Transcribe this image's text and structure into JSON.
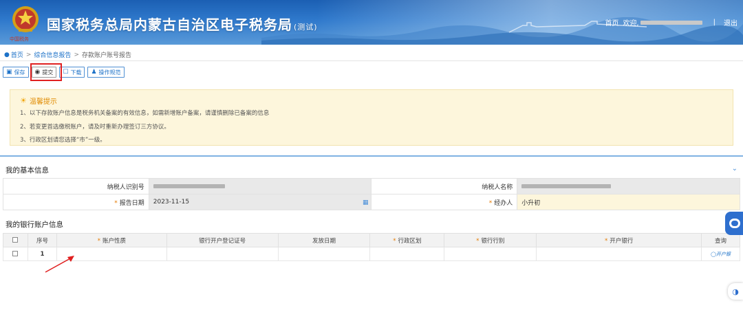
{
  "header": {
    "site_title": "国家税务总局内蒙古自治区电子税务局",
    "test_suffix": "(测试)",
    "logo_caption": "中国税务",
    "home_link": "首页",
    "welcome": "欢迎,",
    "separator": "|",
    "logout": "退出"
  },
  "breadcrumb": {
    "items": [
      "首页",
      "综合信息报告",
      "存款账户账号报告"
    ]
  },
  "toolbar": {
    "save": "保存",
    "submit": "提交",
    "download": "下载",
    "guide": "操作规范"
  },
  "tips": {
    "title": "温馨提示",
    "lines": [
      "1、以下存款账户信息是税务机关备案的有效信息，如需新增账户备案，请谨慎删除已备案的信息",
      "2、若变更首选缴税账户，请及时重新办理签订三方协议。",
      "3、行政区划请您选择“市”一级。"
    ]
  },
  "basic_info": {
    "title": "我的基本信息",
    "taxpayer_id_label": "纳税人识别号",
    "taxpayer_name_label": "纳税人名称",
    "report_date_label": "报告日期",
    "report_date_value": "2023-11-15",
    "handler_label": "经办人",
    "handler_value": "小升初"
  },
  "bank_info": {
    "title": "我的银行账户信息",
    "columns": [
      "序号",
      "账户性质",
      "银行开户登记证号",
      "发放日期",
      "行政区划",
      "银行行别",
      "开户银行",
      "查询"
    ],
    "required_columns": [
      "账户性质",
      "行政区划",
      "银行行别",
      "开户银行"
    ],
    "rows": [
      {
        "index": "1",
        "query": "开户银"
      }
    ]
  },
  "colors": {
    "accent": "#1d72c8",
    "highlight": "#e02020",
    "tips_bg": "#fdf6dc",
    "required": "#e47a00"
  },
  "icons": [
    "location-pin-icon",
    "save-icon",
    "submit-icon",
    "download-icon",
    "guide-icon",
    "lightbulb-icon",
    "chevron-down-icon",
    "calendar-icon",
    "chat-widget-icon",
    "assistant-widget-icon"
  ]
}
